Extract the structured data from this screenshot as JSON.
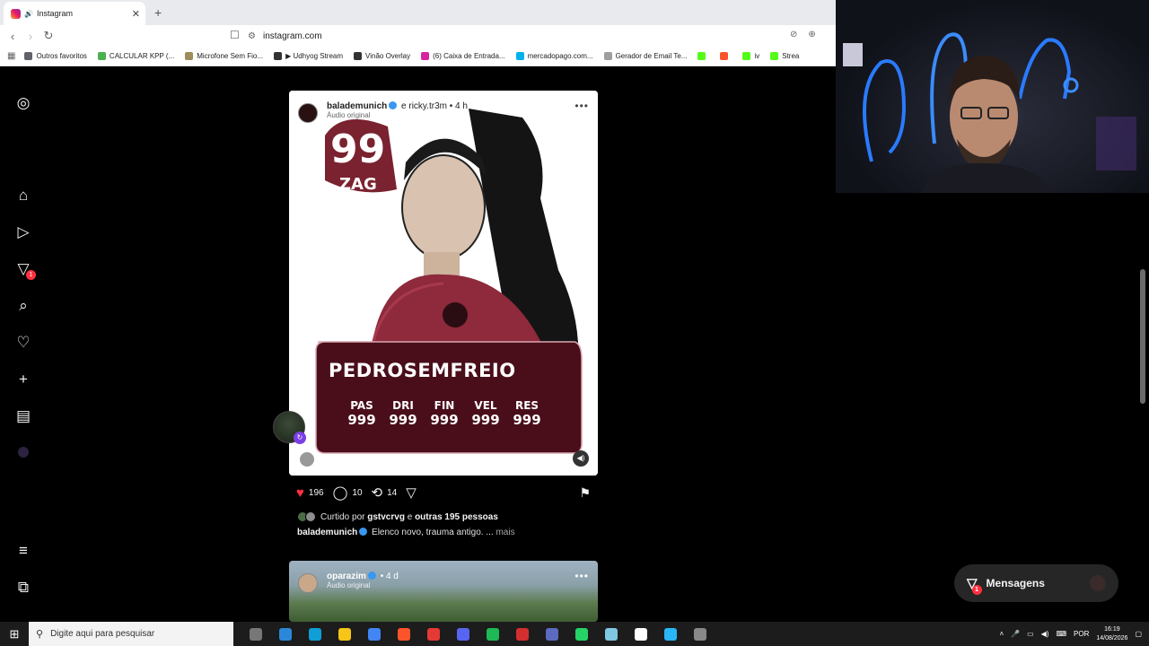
{
  "browser": {
    "tab_title": "Instagram",
    "new_tab": "+",
    "url": "instagram.com",
    "bookmarks": [
      {
        "label": "Outros favoritos",
        "color": "#5f6368"
      },
      {
        "label": "CALCULAR KPP (...",
        "color": "#4caf50"
      },
      {
        "label": "Microfone Sem Fio...",
        "color": "#9e8c5a"
      },
      {
        "label": "▶ Udhyog Stream",
        "color": "#333333"
      },
      {
        "label": "Vinão Overlay",
        "color": "#333333"
      },
      {
        "label": "(6) Caixa de Entrada...",
        "color": "#d6249f"
      },
      {
        "label": "mercadopago.com...",
        "color": "#00b1ea"
      },
      {
        "label": "Gerador de Email Te...",
        "color": "#9e9e9e"
      },
      {
        "label": "",
        "color": "#53fc18"
      },
      {
        "label": "",
        "color": "#fb542b"
      },
      {
        "label": "iv",
        "color": "#53fc18"
      },
      {
        "label": "Strea",
        "color": "#53fc18"
      }
    ]
  },
  "sidebar": {
    "dm_badge": "1"
  },
  "post": {
    "username": "balademunich",
    "collab": "e ricky.tr3m",
    "time": "• 4 h",
    "audio": "Áudio original",
    "card": {
      "rating": "99",
      "position": "ZAG",
      "name": "PEDROSEMFREIO",
      "stats": [
        {
          "key": "PAS",
          "value": "999"
        },
        {
          "key": "DRI",
          "value": "999"
        },
        {
          "key": "FIN",
          "value": "999"
        },
        {
          "key": "VEL",
          "value": "999"
        },
        {
          "key": "RES",
          "value": "999"
        }
      ]
    },
    "likes": "196",
    "comments": "10",
    "reposts": "14",
    "liked_by_prefix": "Curtido por",
    "liked_by_user": "gstvcrvg",
    "liked_by_and": "e",
    "liked_by_others": "outras 195 pessoas",
    "caption_user": "balademunich",
    "caption_text": "Elenco novo, trauma antigo. ...",
    "caption_more": "mais"
  },
  "post2": {
    "username": "oparazim",
    "time": "• 4 d",
    "audio": "Áudio original"
  },
  "messages": {
    "label": "Mensagens",
    "badge": "1"
  },
  "taskbar": {
    "search_placeholder": "Digite aqui para pesquisar",
    "language": "POR",
    "time": "16:19",
    "date": "14/08/2026",
    "app_colors": [
      "#777777",
      "#2b88d8",
      "#0f9ed5",
      "#f5c518",
      "#4285f4",
      "#fb542b",
      "#e53935",
      "#5865f2",
      "#1db954",
      "#d32f2f",
      "#5c6bc0",
      "#25d366",
      "#7ec8e3",
      "#ffffff",
      "#29b6f6",
      "#888888"
    ]
  }
}
